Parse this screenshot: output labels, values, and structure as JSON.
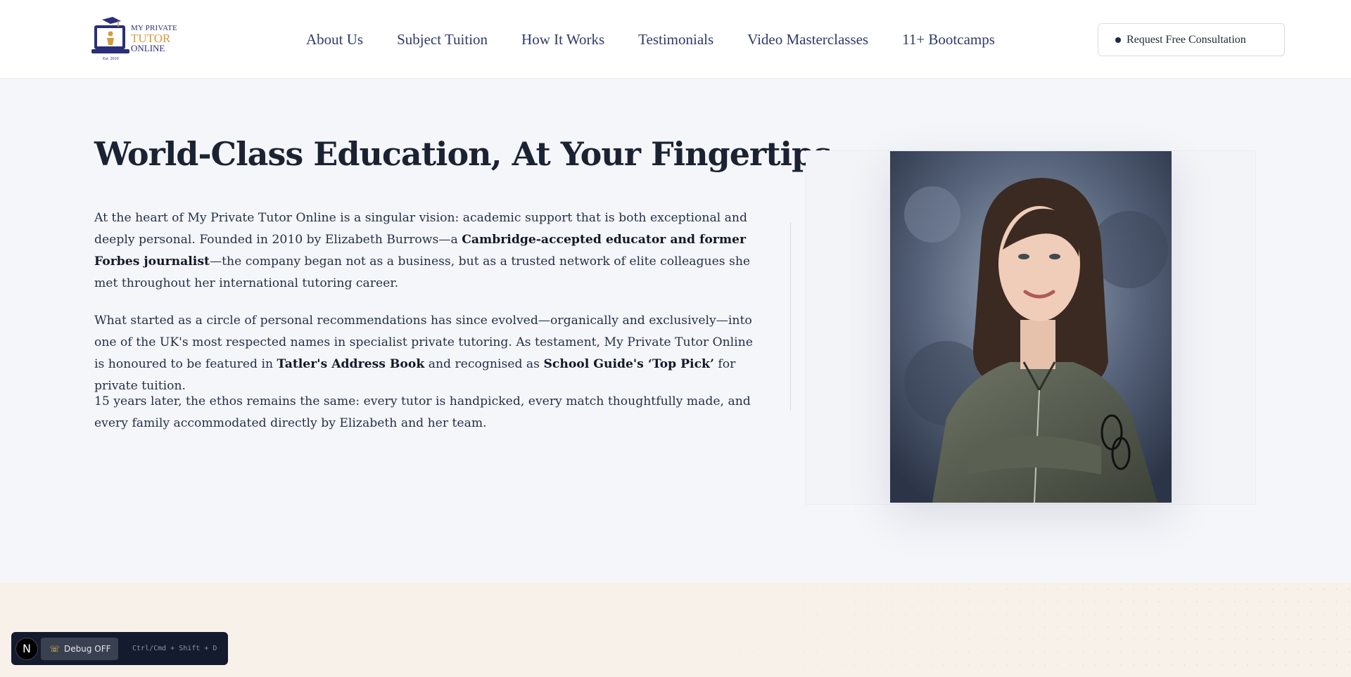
{
  "header": {
    "logo": {
      "line1": "MY PRIVATE",
      "line2": "TUTOR",
      "line3": "ONLINE",
      "est": "Est. 2010"
    },
    "nav": [
      {
        "label": "About Us"
      },
      {
        "label": "Subject Tuition"
      },
      {
        "label": "How It Works"
      },
      {
        "label": "Testimonials"
      },
      {
        "label": "Video Masterclasses"
      },
      {
        "label": "11+ Bootcamps"
      }
    ],
    "cta_label": "Request Free Consultation"
  },
  "hero": {
    "title": "World-Class Education, At Your Fingertips.",
    "p1": {
      "a": "At the heart of My Private Tutor Online is a singular vision: academic support that is both exceptional and deeply personal. Founded in 2010 by Elizabeth Burrows—a ",
      "b": "Cambridge-accepted educator and former Forbes journalist",
      "c": "—the company began not as a business, but as a trusted network of elite colleagues she met throughout her international tutoring career."
    },
    "p2": {
      "a": "What started as a circle of personal recommendations has since evolved—organically and exclusively—into one of the UK's most respected names in specialist private tutoring. As testament, My Private Tutor Online is honoured to be featured in ",
      "b": "Tatler's Address Book",
      "c": " and recognised as ",
      "d": "School Guide's ‘Top Pick’",
      "e": " for private tuition."
    },
    "p3": "15 years later, the ethos remains the same: every tutor is handpicked, every match thoughtfully made, and every family accommodated directly by Elizabeth and her team."
  },
  "debug": {
    "badge": "N",
    "button_label": "Debug OFF",
    "hint": "Ctrl/Cmd + Shift + D"
  }
}
